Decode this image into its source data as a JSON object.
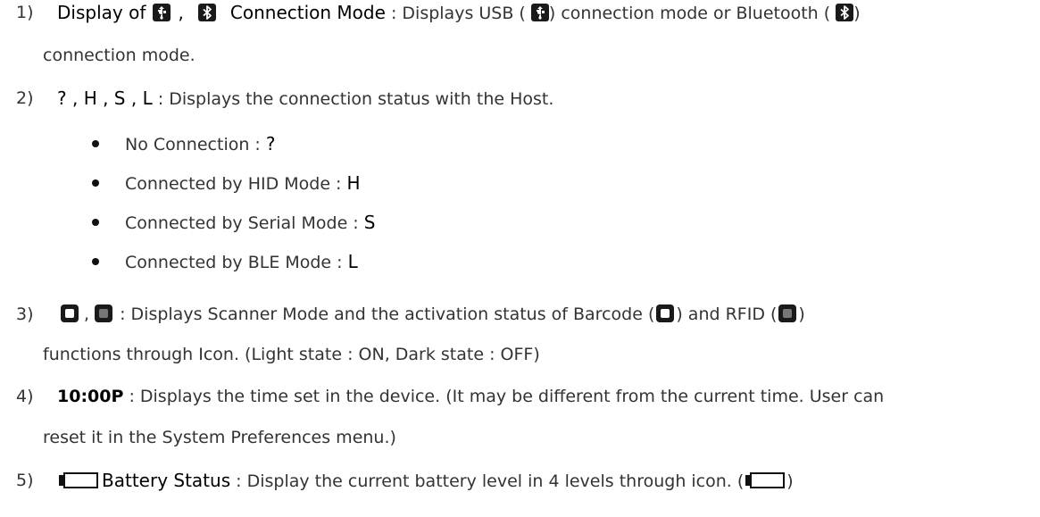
{
  "items": [
    {
      "number": "1)",
      "keyword_prefix": "Display of",
      "comma": ",",
      "keyword_suffix": "Connection Mode",
      "separator": " : ",
      "text_a": "Displays USB (",
      "text_b": ") connection mode or Bluetooth (",
      "text_c": ")",
      "continuation": "connection mode."
    },
    {
      "number": "2)",
      "keyword": "? , H , S , L",
      "separator": " : ",
      "text": "Displays the connection status with the Host.",
      "bullets": [
        {
          "label": "No Connection : ",
          "value": "?"
        },
        {
          "label": "Connected by HID Mode : ",
          "value": "H"
        },
        {
          "label": "Connected by Serial Mode : ",
          "value": "S"
        },
        {
          "label": "Connected by BLE Mode : ",
          "value": "L"
        }
      ]
    },
    {
      "number": "3)",
      "comma": ",",
      "separator": " : ",
      "text_a": "Displays Scanner Mode and the activation status of Barcode (",
      "text_b": ") and RFID (",
      "text_c": ")",
      "continuation": "functions through Icon. (Light state : ON, Dark state : OFF)"
    },
    {
      "number": "4)",
      "keyword": "10:00P",
      "separator": " : ",
      "text": "Displays the time set in the device. (It may be different from the current time. User can",
      "continuation": "reset it in the System Preferences menu.)"
    },
    {
      "number": "5)",
      "keyword": "Battery Status",
      "separator": " : ",
      "text_a": "Display the current battery level in 4 levels through icon. (",
      "text_b": ")"
    }
  ],
  "icons": {
    "usb": "usb-icon",
    "bluetooth": "bluetooth-icon",
    "barcode": "barcode-mode-icon",
    "rfid": "rfid-mode-icon",
    "battery": "battery-icon"
  }
}
